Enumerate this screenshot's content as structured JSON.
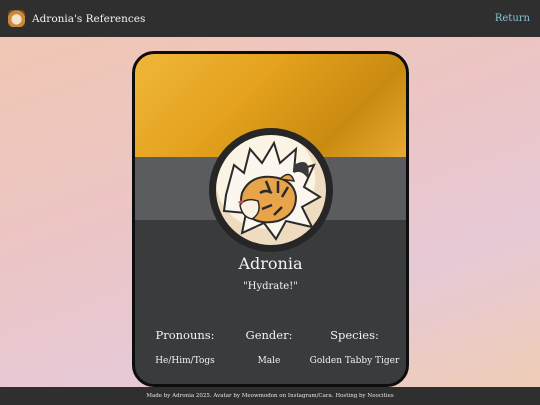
{
  "header": {
    "title": "Adronia's References",
    "return_label": "Return",
    "logo_icon": "tiger-face-icon"
  },
  "profile": {
    "name": "Adronia",
    "quote": "\"Hydrate!\"",
    "avatar_icon": "tiger-avatar-illustration",
    "info": [
      {
        "label": "Pronouns:",
        "value": "He/Him/Togs"
      },
      {
        "label": "Gender:",
        "value": "Male"
      },
      {
        "label": "Species:",
        "value": "Golden Tabby Tiger"
      }
    ]
  },
  "footer": {
    "text": "Made by Adronia 2025. Avatar by Meowmodon on Instagram/Cara. Hosting by Neocities"
  },
  "colors": {
    "topbar": "#2f2f2f",
    "card": "#3a3b3c",
    "banner_gold": "#e4a21e",
    "band": "#5b5c5f",
    "link": "#86c5d6"
  }
}
